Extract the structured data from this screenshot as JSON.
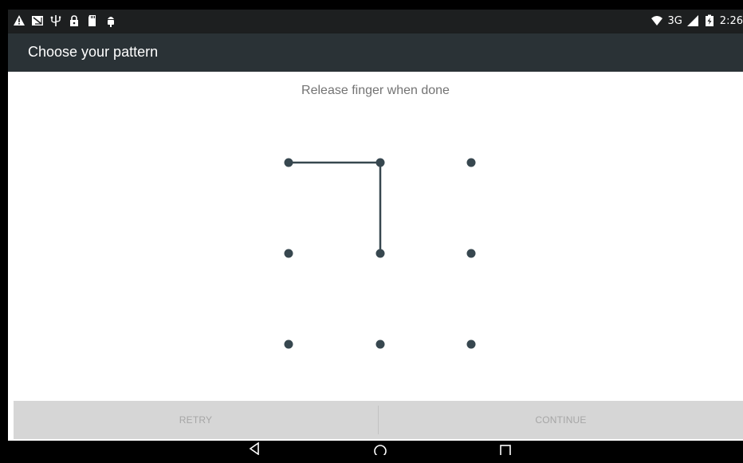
{
  "status_bar": {
    "left_icons": [
      "warning-icon",
      "screenshot-icon",
      "usb-icon",
      "lock-icon",
      "sd-card-icon",
      "android-icon"
    ],
    "network_type": "3G",
    "time": "2:26"
  },
  "action_bar": {
    "title": "Choose your pattern"
  },
  "pattern": {
    "header": "Release finger when done",
    "grid_size": 3,
    "selected_sequence": [
      0,
      1,
      4
    ],
    "dot_color": "#37474f",
    "line_color": "#37474f"
  },
  "footer": {
    "retry_label": "RETRY",
    "continue_label": "CONTINUE"
  },
  "nav_bar": {
    "buttons": [
      "back-icon",
      "home-icon",
      "recents-icon"
    ]
  },
  "colors": {
    "status_bar": "#1d1f20",
    "action_bar": "#2a3236",
    "footer": "#d6d6d6",
    "footer_text_disabled": "#a6a6a6",
    "header_text": "#737373"
  }
}
